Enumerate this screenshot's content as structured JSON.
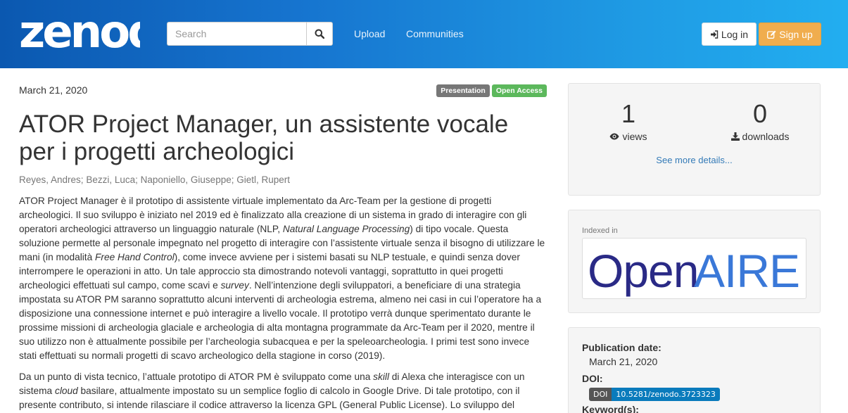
{
  "header": {
    "logo_text": "zenodo",
    "search_placeholder": "Search",
    "nav": {
      "upload": "Upload",
      "communities": "Communities"
    },
    "login_label": "Log in",
    "signup_label": "Sign up"
  },
  "record": {
    "date": "March 21, 2020",
    "badge_type": "Presentation",
    "badge_access": "Open Access",
    "title": "ATOR Project Manager, un assistente vocale per i progetti archeologici",
    "authors": [
      "Reyes, Andres",
      "Bezzi, Luca",
      "Naponiello, Giuseppe",
      "Gietl, Rupert"
    ],
    "description": {
      "p1": [
        "ATOR Project Manager è il prototipo di assistente virtuale implementato da Arc-Team per la gestione di progetti archeologici. Il suo sviluppo è iniziato nel 2019 ed è finalizzato alla creazione di un sistema in grado di interagire con gli operatori archeologici attraverso un linguaggio naturale (NLP, ",
        "Natural Language Processing",
        ") di tipo vocale. Questa soluzione permette al personale impegnato nel progetto di interagire con l’assistente virtuale senza il bisogno di utilizzare le mani (in modalità ",
        "Free Hand Control",
        "), come invece avviene per i sistemi basati su NLP testuale, e quindi senza dover interrompere le operazioni in atto. Un tale approccio sta dimostrando notevoli vantaggi, soprattutto in quei progetti archeologici effettuati sul campo, come scavi e ",
        "survey",
        ". Nell’intenzione degli sviluppatori, a beneficiare di una strategia impostata su ATOR PM saranno soprattutto alcuni interventi di archeologia estrema, almeno nei casi in cui l’operatore ha a disposizione una connessione internet e può interagire a livello vocale. Il prototipo verrà dunque sperimentato durante le prossime missioni di archeologia glaciale e archeologia di alta montagna programmate da Arc-Team per il 2020, mentre il suo utilizzo non è attualmente possibile per l’archeologia subacquea e per la speleoarcheologia. I primi test sono invece stati effettuati su normali progetti di scavo archeologico della stagione in corso (2019)."
      ],
      "p2": [
        "Da un punto di vista tecnico, l’attuale prototipo di ATOR PM è sviluppato come una ",
        "skill",
        " di Alexa che interagisce con un sistema ",
        "cloud",
        " basilare, attualmente impostato su un semplice foglio di calcolo in Google Drive. Di tale prototipo, con il presente contributo, si intende rilasciare il codice attraverso la licenza GPL (General Public License). Lo sviluppo del"
      ]
    }
  },
  "stats": {
    "views": "1",
    "views_label": "views",
    "downloads": "0",
    "downloads_label": "downloads",
    "see_more": "See more details..."
  },
  "indexed": {
    "label": "Indexed in",
    "logo_text_dark": "Open",
    "logo_text_light": "AIRE"
  },
  "details": {
    "pub_date_label": "Publication date:",
    "pub_date": "March 21, 2020",
    "doi_label": "DOI:",
    "doi_tag": "DOI",
    "doi": "10.5281/zenodo.3723323",
    "keywords_label": "Keyword(s):"
  },
  "colors": {
    "header_start": "#0b58b0",
    "header_end": "#22aef0",
    "signup": "#f0ad4e",
    "open_access": "#5cb85c",
    "link": "#337ab7",
    "openaire_dark": "#2a2a86",
    "openaire_light": "#3a78d8"
  }
}
